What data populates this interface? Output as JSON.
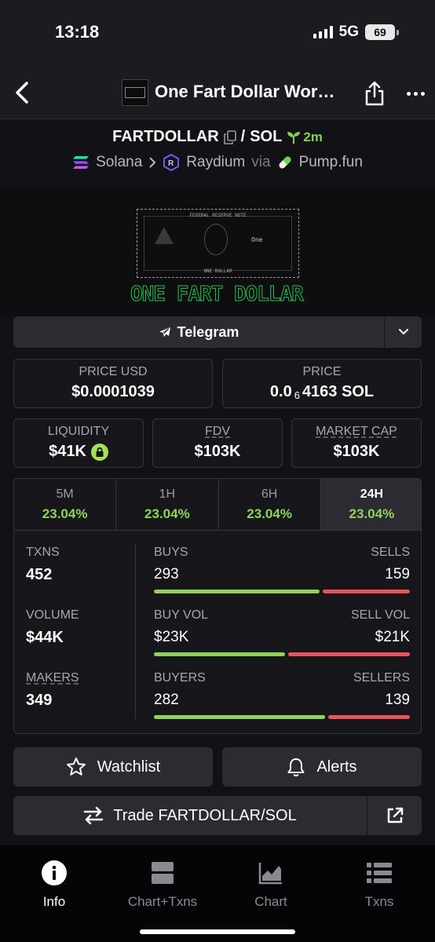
{
  "status": {
    "time": "13:18",
    "network": "5G",
    "battery": "69"
  },
  "header": {
    "title": "One Fart Dollar Wor…"
  },
  "pair": {
    "base": "FARTDOLLAR",
    "separator": "/",
    "quote": "SOL",
    "age": "2m",
    "chain": "Solana",
    "dex": "Raydium",
    "via": "via",
    "launchpad": "Pump.fun"
  },
  "banner": {
    "bill_header": "FEDERAL RESERVE NOTE",
    "bill_center": "One",
    "bill_footer": "ONE DOLLAR",
    "title": "ONE FART DOLLAR"
  },
  "socials": {
    "telegram_label": "Telegram"
  },
  "prices": {
    "price_usd_label": "PRICE USD",
    "price_usd": "$0.0001039",
    "price_label": "PRICE",
    "price_prefix": "0.0",
    "price_sub": "6",
    "price_suffix": "4163 SOL"
  },
  "metrics": {
    "liquidity_label": "LIQUIDITY",
    "liquidity": "$41K",
    "fdv_label": "FDV",
    "fdv": "$103K",
    "mcap_label": "MARKET CAP",
    "mcap": "$103K"
  },
  "timeframes": [
    {
      "label": "5M",
      "change": "23.04%"
    },
    {
      "label": "1H",
      "change": "23.04%"
    },
    {
      "label": "6H",
      "change": "23.04%"
    },
    {
      "label": "24H",
      "change": "23.04%"
    }
  ],
  "stats": {
    "txns_label": "TXNS",
    "txns": "452",
    "buys_label": "BUYS",
    "buys": "293",
    "sells_label": "SELLS",
    "sells": "159",
    "volume_label": "VOLUME",
    "volume": "$44K",
    "buy_vol_label": "BUY VOL",
    "buy_vol": "$23K",
    "sell_vol_label": "SELL VOL",
    "sell_vol": "$21K",
    "makers_label": "MAKERS",
    "makers": "349",
    "buyers_label": "BUYERS",
    "buyers": "282",
    "sellers_label": "SELLERS",
    "sellers": "139"
  },
  "actions": {
    "watchlist": "Watchlist",
    "alerts": "Alerts",
    "trade": "Trade FARTDOLLAR/SOL"
  },
  "nav": [
    {
      "label": "Info",
      "icon": "info-icon"
    },
    {
      "label": "Chart+Txns",
      "icon": "chart-txns-icon"
    },
    {
      "label": "Chart",
      "icon": "chart-icon"
    },
    {
      "label": "Txns",
      "icon": "list-icon"
    }
  ],
  "colors": {
    "up": "#8fd35a",
    "down": "#e8545a",
    "background": "#121216"
  }
}
